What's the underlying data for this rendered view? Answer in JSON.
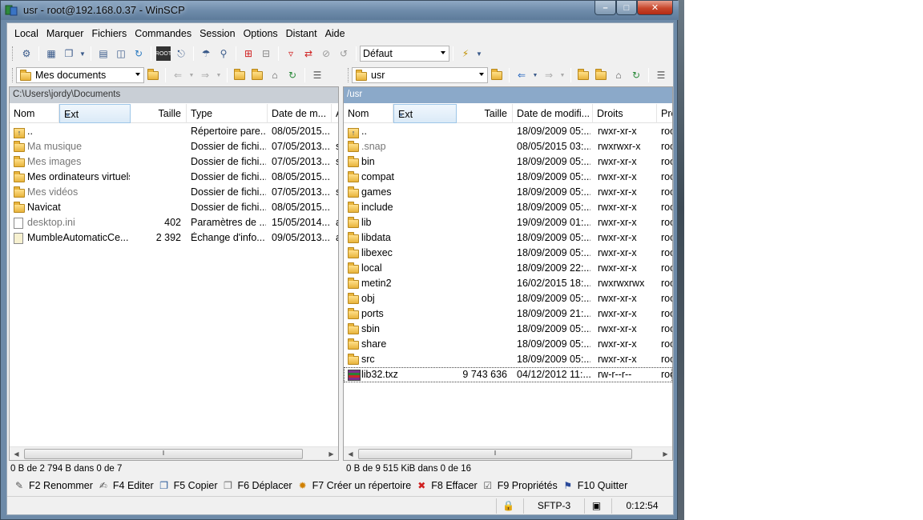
{
  "window": {
    "title": "usr - root@192.168.0.37 - WinSCP",
    "min": "–",
    "max": "□",
    "close": "✕"
  },
  "menu": [
    "Local",
    "Marquer",
    "Fichiers",
    "Commandes",
    "Session",
    "Options",
    "Distant",
    "Aide"
  ],
  "toolbar": {
    "profile": "Défaut"
  },
  "left": {
    "location": "Mes documents",
    "path": "C:\\Users\\jordy\\Documents",
    "headers": {
      "name": "Nom",
      "ext": "Ext",
      "size": "Taille",
      "type": "Type",
      "date": "Date de m...",
      "attr": "A"
    },
    "rows": [
      {
        "name": "..",
        "size": "",
        "type": "Répertoire pare...",
        "date": "08/05/2015...",
        "attr": "",
        "icon": "up-icon",
        "dim": false
      },
      {
        "name": "Ma musique",
        "size": "",
        "type": "Dossier de fichi...",
        "date": "07/05/2013...",
        "attr": "s",
        "icon": "folder-icon",
        "dim": true
      },
      {
        "name": "Mes images",
        "size": "",
        "type": "Dossier de fichi...",
        "date": "07/05/2013...",
        "attr": "s",
        "icon": "folder-icon",
        "dim": true
      },
      {
        "name": "Mes ordinateurs virtuels",
        "size": "",
        "type": "Dossier de fichi...",
        "date": "08/05/2015...",
        "attr": "",
        "icon": "folder-icon",
        "dim": false
      },
      {
        "name": "Mes vidéos",
        "size": "",
        "type": "Dossier de fichi...",
        "date": "07/05/2013...",
        "attr": "s",
        "icon": "folder-icon",
        "dim": true
      },
      {
        "name": "Navicat",
        "size": "",
        "type": "Dossier de fichi...",
        "date": "08/05/2015...",
        "attr": "",
        "icon": "folder-icon",
        "dim": false
      },
      {
        "name": "desktop.ini",
        "size": "402",
        "type": "Paramètres de ...",
        "date": "15/05/2014...",
        "attr": "a",
        "icon": "document-icon",
        "dim": true
      },
      {
        "name": "MumbleAutomaticCe...",
        "size": "2 392",
        "type": "Échange d'info...",
        "date": "09/05/2013...",
        "attr": "a",
        "icon": "certificate-icon",
        "dim": false
      }
    ],
    "status": "0 B de 2 794 B dans 0 de 7"
  },
  "right": {
    "location": "usr",
    "path": "/usr",
    "headers": {
      "name": "Nom",
      "ext": "Ext",
      "size": "Taille",
      "date": "Date de modifi...",
      "rights": "Droits",
      "owner": "Pro"
    },
    "rows": [
      {
        "name": "..",
        "size": "",
        "date": "18/09/2009 05:...",
        "rights": "rwxr-xr-x",
        "owner": "roo",
        "icon": "up-icon",
        "dim": false
      },
      {
        "name": ".snap",
        "size": "",
        "date": "08/05/2015 03:...",
        "rights": "rwxrwxr-x",
        "owner": "roo",
        "icon": "folder-icon",
        "dim": true
      },
      {
        "name": "bin",
        "size": "",
        "date": "18/09/2009 05:...",
        "rights": "rwxr-xr-x",
        "owner": "roo",
        "icon": "folder-icon",
        "dim": false
      },
      {
        "name": "compat",
        "size": "",
        "date": "18/09/2009 05:...",
        "rights": "rwxr-xr-x",
        "owner": "roo",
        "icon": "folder-icon",
        "dim": false
      },
      {
        "name": "games",
        "size": "",
        "date": "18/09/2009 05:...",
        "rights": "rwxr-xr-x",
        "owner": "roo",
        "icon": "folder-icon",
        "dim": false
      },
      {
        "name": "include",
        "size": "",
        "date": "18/09/2009 05:...",
        "rights": "rwxr-xr-x",
        "owner": "roo",
        "icon": "folder-icon",
        "dim": false
      },
      {
        "name": "lib",
        "size": "",
        "date": "19/09/2009 01:...",
        "rights": "rwxr-xr-x",
        "owner": "roo",
        "icon": "folder-icon",
        "dim": false
      },
      {
        "name": "libdata",
        "size": "",
        "date": "18/09/2009 05:...",
        "rights": "rwxr-xr-x",
        "owner": "roo",
        "icon": "folder-icon",
        "dim": false
      },
      {
        "name": "libexec",
        "size": "",
        "date": "18/09/2009 05:...",
        "rights": "rwxr-xr-x",
        "owner": "roo",
        "icon": "folder-icon",
        "dim": false
      },
      {
        "name": "local",
        "size": "",
        "date": "18/09/2009 22:...",
        "rights": "rwxr-xr-x",
        "owner": "roo",
        "icon": "folder-icon",
        "dim": false
      },
      {
        "name": "metin2",
        "size": "",
        "date": "16/02/2015 18:...",
        "rights": "rwxrwxrwx",
        "owner": "roo",
        "icon": "folder-icon",
        "dim": false
      },
      {
        "name": "obj",
        "size": "",
        "date": "18/09/2009 05:...",
        "rights": "rwxr-xr-x",
        "owner": "roo",
        "icon": "folder-icon",
        "dim": false
      },
      {
        "name": "ports",
        "size": "",
        "date": "18/09/2009 21:...",
        "rights": "rwxr-xr-x",
        "owner": "roo",
        "icon": "folder-icon",
        "dim": false
      },
      {
        "name": "sbin",
        "size": "",
        "date": "18/09/2009 05:...",
        "rights": "rwxr-xr-x",
        "owner": "roo",
        "icon": "folder-icon",
        "dim": false
      },
      {
        "name": "share",
        "size": "",
        "date": "18/09/2009 05:...",
        "rights": "rwxr-xr-x",
        "owner": "roo",
        "icon": "folder-icon",
        "dim": false
      },
      {
        "name": "src",
        "size": "",
        "date": "18/09/2009 05:...",
        "rights": "rwxr-xr-x",
        "owner": "roo",
        "icon": "folder-icon",
        "dim": false
      },
      {
        "name": "lib32.txz",
        "size": "9 743 636",
        "date": "04/12/2012 11:...",
        "rights": "rw-r--r--",
        "owner": "roo",
        "icon": "archive-icon",
        "dim": false,
        "focus": true
      }
    ],
    "status": "0 B de 9 515 KiB dans 0 de 16"
  },
  "fkeys": [
    {
      "label": "F2 Renommer",
      "icon": "rename-icon",
      "glyph": "✎",
      "color": "#555555"
    },
    {
      "label": "F4 Editer",
      "icon": "edit-icon",
      "glyph": "✍",
      "color": "#555555"
    },
    {
      "label": "F5 Copier",
      "icon": "copy-icon",
      "glyph": "❐",
      "color": "#2a5a9a"
    },
    {
      "label": "F6 Déplacer",
      "icon": "move-icon",
      "glyph": "❐",
      "color": "#6a6a6a"
    },
    {
      "label": "F7 Créer un répertoire",
      "icon": "new-folder-icon",
      "glyph": "✹",
      "color": "#d08000"
    },
    {
      "label": "F8 Effacer",
      "icon": "delete-icon",
      "glyph": "✖",
      "color": "#d02020"
    },
    {
      "label": "F9 Propriétés",
      "icon": "properties-icon",
      "glyph": "☑",
      "color": "#555555"
    },
    {
      "label": "F10 Quitter",
      "icon": "quit-icon",
      "glyph": "⚑",
      "color": "#2a4a9a"
    }
  ],
  "statusbar": {
    "lock": "🔒",
    "protocol": "SFTP-3",
    "time": "0:12:54"
  }
}
